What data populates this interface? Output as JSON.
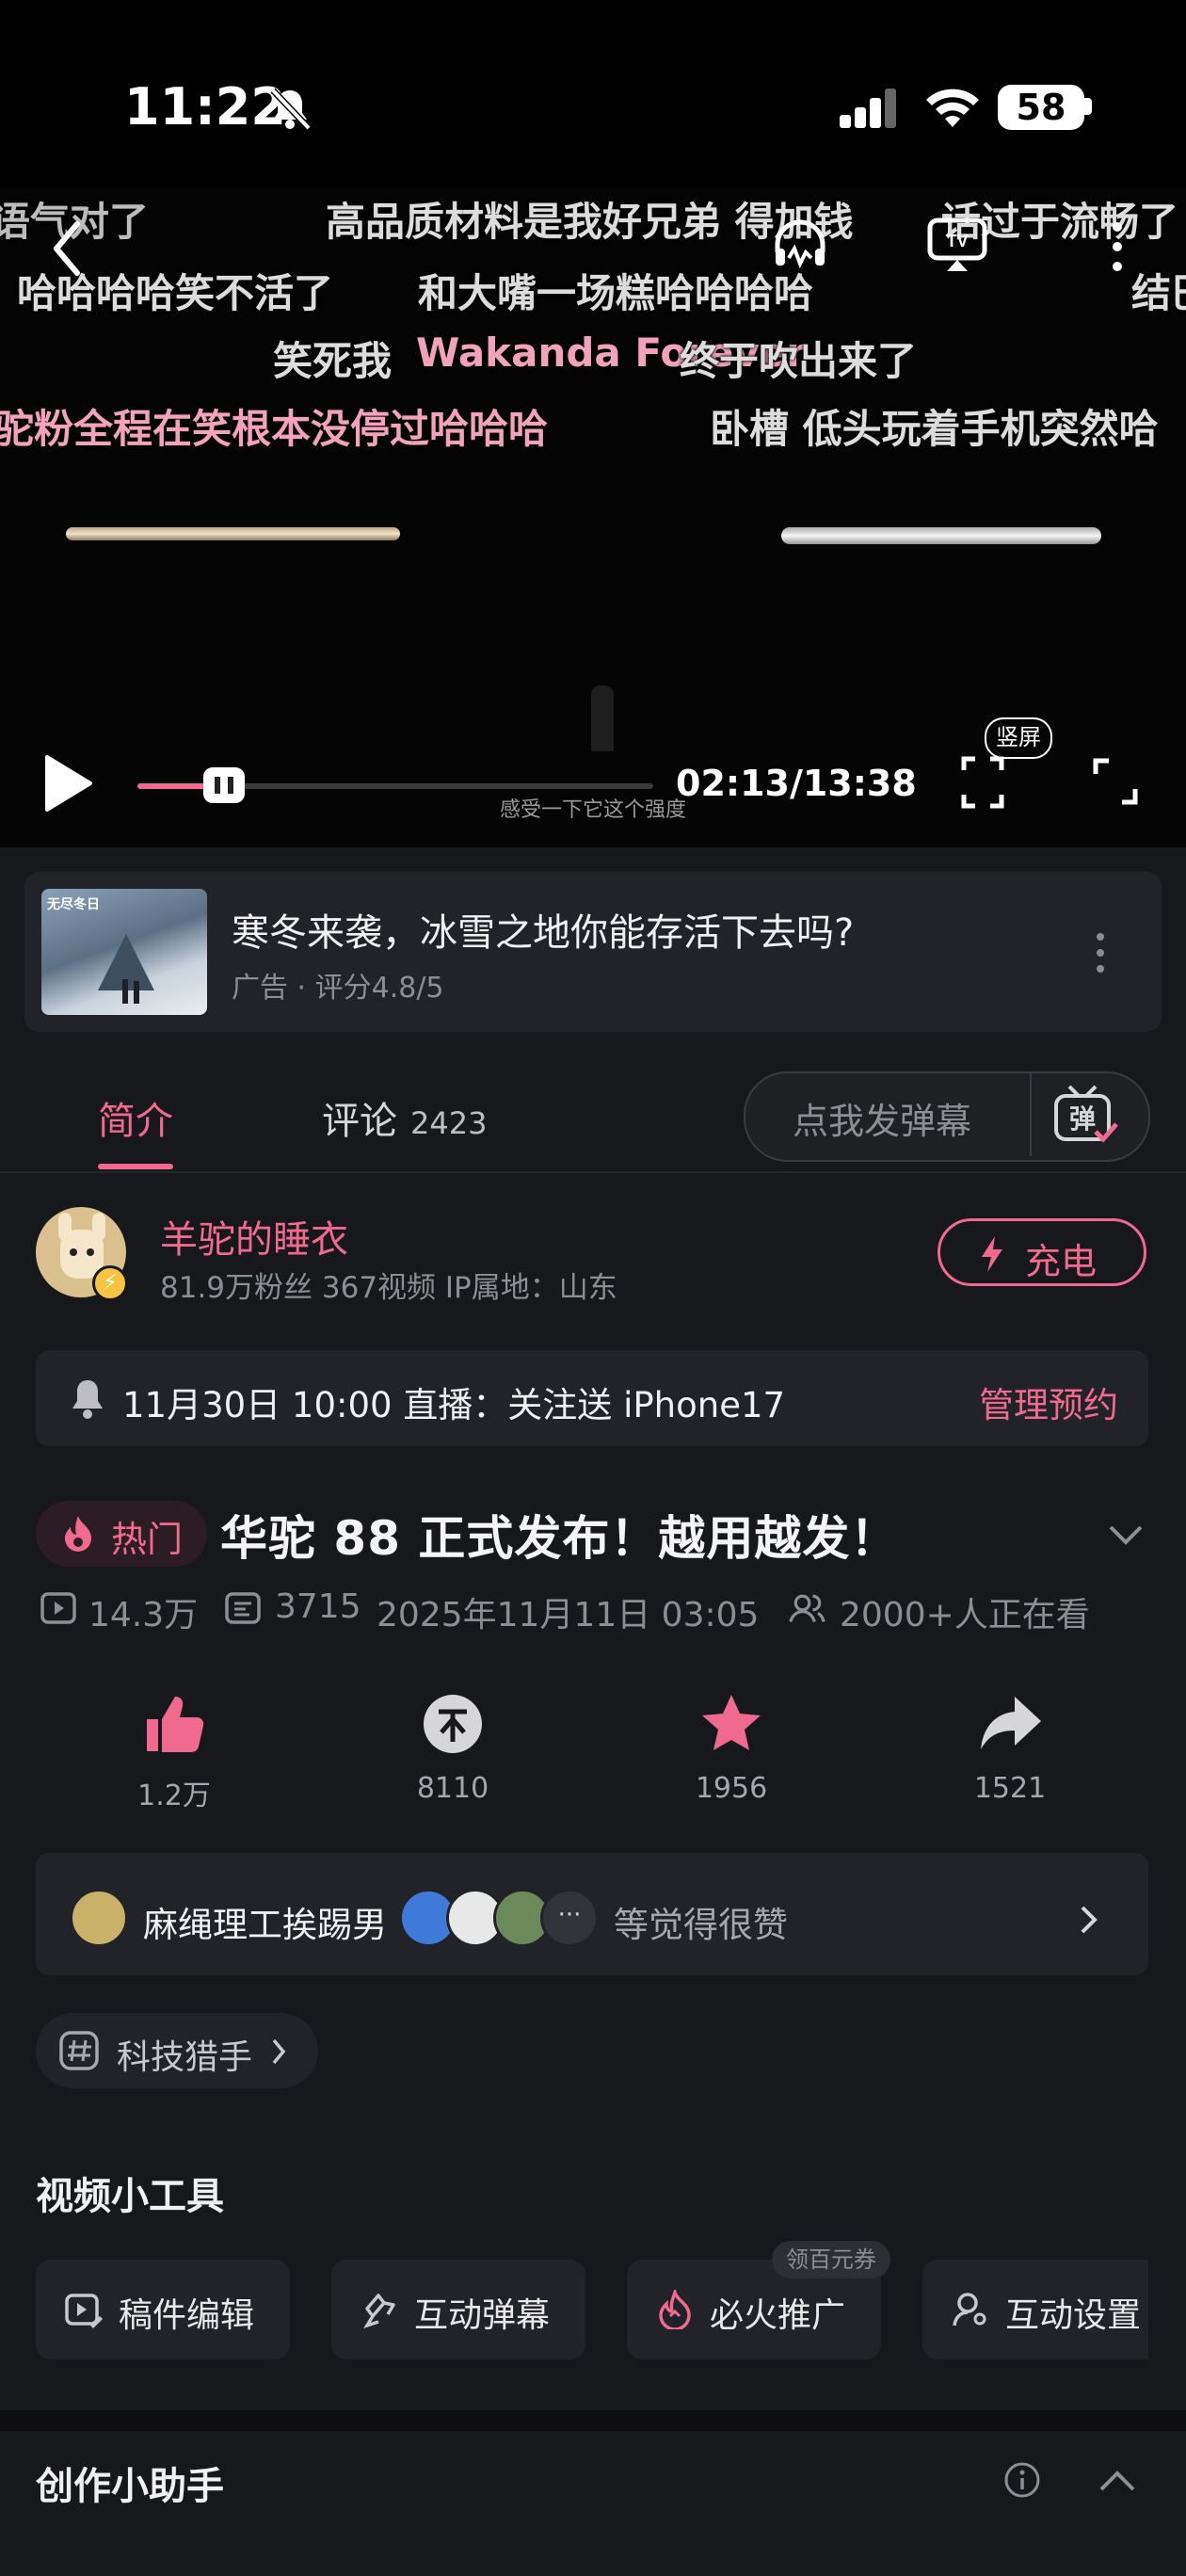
{
  "status_bar": {
    "time": "11:22",
    "battery": "58"
  },
  "video": {
    "danmaku": [
      "语气对了",
      "高品质材料是我好兄弟 得加钱",
      "话过于流畅了",
      "哈哈哈哈笑不活了",
      "和大嘴一场糕哈哈哈哈",
      "结巴",
      "笑死我",
      "Wakanda Forever",
      "终于吹出来了",
      "驼粉全程在笑根本没停过哈哈哈",
      "卧槽 低头玩着手机突然哈"
    ],
    "subtitle": "感受一下它这个强度",
    "time_display": "02:13/13:38",
    "progress": 0.168,
    "vertical_label": "竖屏"
  },
  "ad": {
    "image_caption": "无尽冬日",
    "title": "寒冬来袭，冰雪之地你能存活下去吗?",
    "subtitle": "广告 · 评分4.8/5"
  },
  "tabs": {
    "intro": "简介",
    "comments": "评论",
    "comments_count": "2423",
    "danmaku_placeholder": "点我发弹幕",
    "danmaku_icon_char": "弹"
  },
  "uploader": {
    "name": "羊驼的睡衣",
    "stats": "81.9万粉丝   367视频   IP属地：山东",
    "charge_label": "充电"
  },
  "live": {
    "text": "11月30日 10:00 直播：关注送 iPhone17",
    "action": "管理预约"
  },
  "title": {
    "hot_label": "热门",
    "text": "华驼 88 正式发布！越用越发！"
  },
  "meta": {
    "views": "14.3万",
    "danmaku_count": "3715",
    "datetime": "2025年11月11日 03:05",
    "watching": "2000+人正在看"
  },
  "actions": {
    "like": "1.2万",
    "coin": "8110",
    "favorite": "1956",
    "share": "1521"
  },
  "likers": {
    "name": "麻绳理工挨踢男",
    "suffix": "等觉得很赞"
  },
  "topic": {
    "label": "科技猎手"
  },
  "tools": {
    "heading": "视频小工具",
    "items": [
      "稿件编辑",
      "互动弹幕",
      "必火推广",
      "互动设置"
    ],
    "badge": "领百元券"
  },
  "assistant": {
    "heading": "创作小助手"
  },
  "colors": {
    "accent": "#f06a8f",
    "background": "#17181b",
    "card": "#222328"
  }
}
